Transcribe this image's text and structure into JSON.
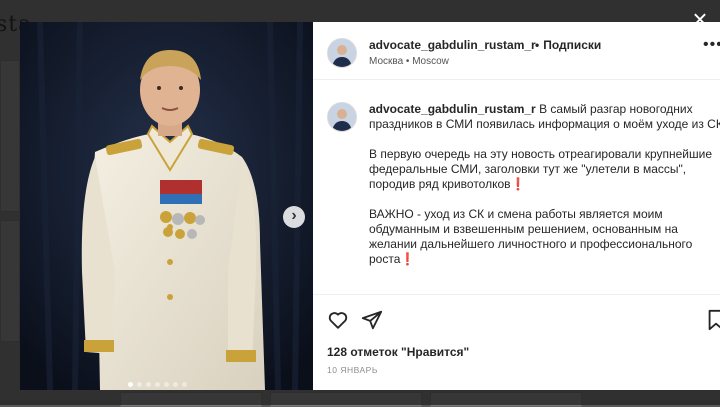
{
  "background": {
    "logo_fragment": "sta"
  },
  "post": {
    "author": "advocate_gabdulin_rustam_r",
    "separator": "•",
    "follow_label": "Подписки",
    "location": "Москва • Moscow",
    "caption_paragraphs": [
      "В самый разгар новогодних праздников в СМИ появилась информация о моём уходе из СК",
      "В первую очередь на эту новость отреагировали крупнейшие федеральные СМИ, заголовки тут же \"улетели в массы\", породив ряд кривотолков❗",
      "ВАЖНО - уход из СК и смена работы является моим обдуманным и взвешенным решением, основанным на желании дальнейшего личностного и профессионального роста❗"
    ],
    "likes": "128 отметок \"Нравится\"",
    "date": "10 ЯНВАРЬ",
    "carousel": {
      "count": 7,
      "active_index": 0
    },
    "accent_color": "#262626"
  },
  "icons": {
    "close": "close-icon",
    "next": "chevron-right-icon",
    "like": "heart-icon",
    "share": "share-icon",
    "save": "bookmark-icon",
    "more": "more-icon"
  }
}
